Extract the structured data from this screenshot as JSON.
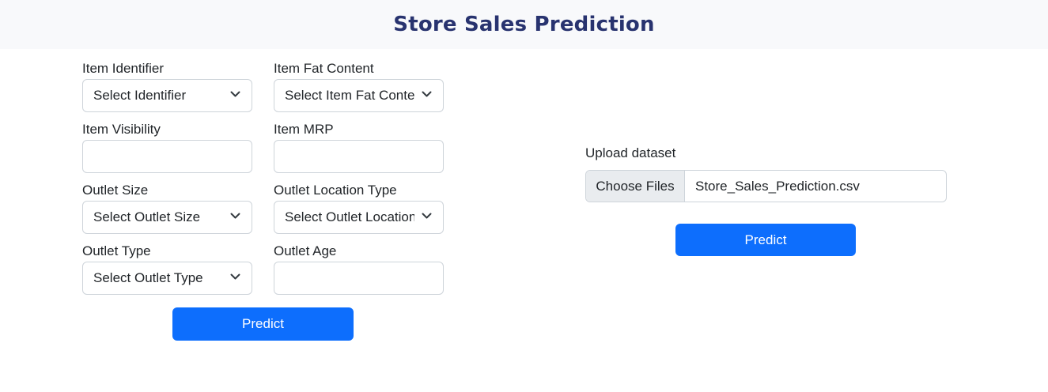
{
  "header": {
    "title": "Store Sales Prediction"
  },
  "form": {
    "item_identifier": {
      "label": "Item Identifier",
      "selected": "Select Identifier"
    },
    "item_fat_content": {
      "label": "Item Fat Content",
      "selected": "Select Item Fat Content"
    },
    "item_visibility": {
      "label": "Item Visibility",
      "value": ""
    },
    "item_mrp": {
      "label": "Item MRP",
      "value": ""
    },
    "outlet_size": {
      "label": "Outlet Size",
      "selected": "Select Outlet Size"
    },
    "outlet_location_type": {
      "label": "Outlet Location Type",
      "selected": "Select Outlet Location Type"
    },
    "outlet_type": {
      "label": "Outlet Type",
      "selected": "Select Outlet Type"
    },
    "outlet_age": {
      "label": "Outlet Age",
      "value": ""
    },
    "predict_label": "Predict"
  },
  "upload": {
    "label": "Upload dataset",
    "choose_label": "Choose Files",
    "file_name": "Store_Sales_Prediction.csv",
    "predict_label": "Predict"
  },
  "colors": {
    "primary": "#0d6efd",
    "title": "#28336f",
    "header_bg": "#f8f9fb"
  },
  "icons": {
    "dropdown": "chevron-down-icon"
  }
}
